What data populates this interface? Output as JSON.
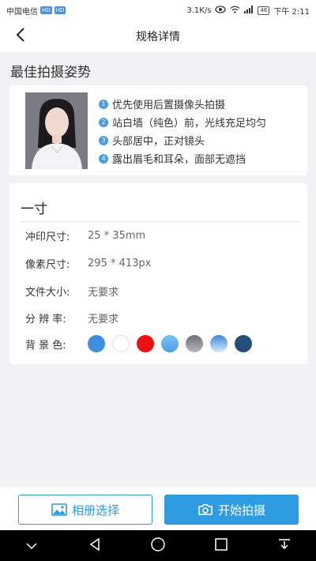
{
  "status_bar": {
    "carrier": "中国电信",
    "hd1": "HD",
    "hd2": "HD",
    "speed": "3.1K/s",
    "battery": "46",
    "time": "下午 2:11"
  },
  "nav": {
    "title": "规格详情"
  },
  "pose": {
    "title": "最佳拍摄姿势",
    "tips": [
      {
        "num": "1",
        "text": "优先使用后置摄像头拍摄"
      },
      {
        "num": "2",
        "text": "站白墙（纯色）前，光线充足均匀"
      },
      {
        "num": "3",
        "text": "头部居中，正对镜头"
      },
      {
        "num": "4",
        "text": "露出眉毛和耳朵，面部无遮挡"
      }
    ]
  },
  "spec": {
    "name": "一寸",
    "print_size_label": "冲印尺寸:",
    "print_size_value": "25 * 35mm",
    "pixel_size_label": "像素尺寸:",
    "pixel_size_value": "295 * 413px",
    "file_size_label": "文件大小:",
    "file_size_value": "无要求",
    "resolution_label": "分 辨 率:",
    "resolution_value": "无要求",
    "bg_label": "背 景 色:",
    "bg_colors": [
      "#3f8fe0",
      "#ffffff",
      "#ee1111",
      "#5caef0",
      "#8a8a92",
      "#7fb6ee",
      "#244f79"
    ]
  },
  "actions": {
    "album_label": "相册选择",
    "shoot_label": "开始拍摄"
  },
  "colors": {
    "accent": "#2f9be0"
  }
}
